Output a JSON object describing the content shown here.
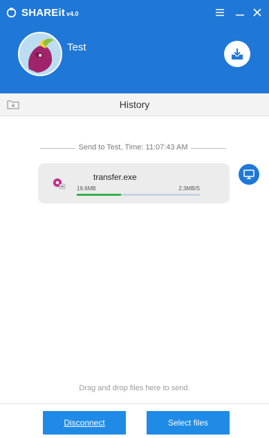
{
  "window": {
    "app_name": "SHAREit",
    "version": "v4.0",
    "buttons": [
      "menu-icon",
      "minimize-icon",
      "close-icon"
    ]
  },
  "profile": {
    "user_name": "Test",
    "download_button_icon": "download-tray-icon"
  },
  "history": {
    "title": "History",
    "send_info": "Send to Test, Time: 11:07:43 AM",
    "transfers": [
      {
        "file_name": "transfer.exe",
        "size": "19.6MB",
        "speed": "2.3MB/S",
        "progress": 0.36,
        "device_icon": "monitor-icon"
      }
    ],
    "drag_hint": "Drag and drop files here to send."
  },
  "footer": {
    "disconnect_label": "Disconnect",
    "select_files_label": "Select files"
  },
  "colors": {
    "header": "#1f78d8",
    "button": "#1f8be6",
    "progress": "#36b14a"
  }
}
